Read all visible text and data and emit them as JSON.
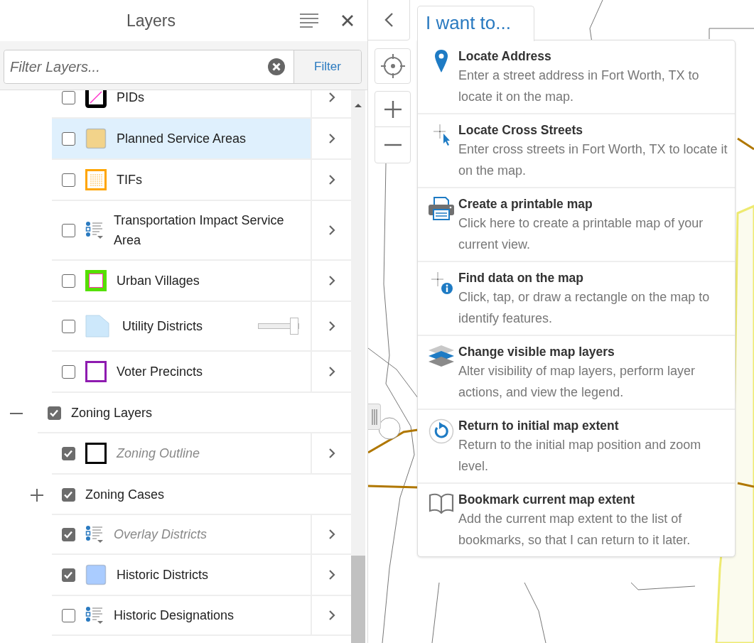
{
  "panel": {
    "title": "Layers"
  },
  "filter": {
    "placeholder": "Filter Layers...",
    "button": "Filter"
  },
  "layer_tree": [
    {
      "kind": "group",
      "children": [
        {
          "kind": "layer",
          "label": "PIDs",
          "checked": false,
          "selected": false,
          "out_of_scale": false,
          "legend": {
            "kind": "hatched",
            "color": "#000000"
          }
        },
        {
          "kind": "layer",
          "label": "Planned Service Areas",
          "checked": false,
          "selected": true,
          "out_of_scale": false,
          "legend": {
            "kind": "fill",
            "color": "#f2d38a"
          }
        },
        {
          "kind": "layer",
          "label": "TIFs",
          "checked": false,
          "selected": false,
          "out_of_scale": false,
          "legend": {
            "kind": "dotted",
            "color": "#ffa500"
          }
        },
        {
          "kind": "layer",
          "label": "Transportation Impact Service Area",
          "checked": false,
          "selected": false,
          "out_of_scale": false,
          "legend": {
            "kind": "list"
          }
        },
        {
          "kind": "layer",
          "label": "Urban Villages",
          "checked": false,
          "selected": false,
          "out_of_scale": false,
          "legend": {
            "kind": "double-outline",
            "color": "#55e000"
          }
        },
        {
          "kind": "layer",
          "label": "Utility Districts",
          "checked": false,
          "selected": false,
          "out_of_scale": false,
          "legend": {
            "kind": "polygon",
            "color": "#cde8fb"
          },
          "opacity": {
            "level": 1
          }
        },
        {
          "kind": "layer",
          "label": "Voter Precincts",
          "checked": false,
          "selected": false,
          "out_of_scale": false,
          "legend": {
            "kind": "outline",
            "color": "#8e1bb0"
          }
        }
      ]
    },
    {
      "kind": "group",
      "label": "Zoning Layers",
      "checked": true,
      "expanded": true,
      "children": [
        {
          "kind": "layer",
          "label": "Zoning Outline",
          "checked": true,
          "selected": false,
          "out_of_scale": true,
          "legend": {
            "kind": "outline",
            "color": "#000000"
          }
        },
        {
          "kind": "group",
          "label": "Zoning Cases",
          "checked": true,
          "expanded": false
        },
        {
          "kind": "layer",
          "label": "Overlay Districts",
          "checked": true,
          "selected": false,
          "out_of_scale": true,
          "legend": {
            "kind": "list"
          }
        },
        {
          "kind": "layer",
          "label": "Historic Districts",
          "checked": true,
          "selected": false,
          "out_of_scale": false,
          "legend": {
            "kind": "fill",
            "color": "#aaccff"
          }
        },
        {
          "kind": "layer",
          "label": "Historic Designations",
          "checked": false,
          "selected": false,
          "out_of_scale": false,
          "legend": {
            "kind": "list"
          }
        }
      ]
    }
  ],
  "menu": {
    "title": "I want to...",
    "items": [
      {
        "kind": "pin",
        "title": "Locate Address",
        "description": "Enter a street address in Fort Worth, TX to locate it on the map."
      },
      {
        "kind": "cross-cursor",
        "title": "Locate Cross Streets",
        "description": "Enter cross streets in Fort Worth, TX to locate it on the map."
      },
      {
        "kind": "printer",
        "title": "Create a printable map",
        "description": "Click here to create a printable map of your current view."
      },
      {
        "kind": "cross-info",
        "title": "Find data on the map",
        "description": "Click, tap, or draw a rectangle on the map to identify features."
      },
      {
        "kind": "layers",
        "title": "Change visible map layers",
        "description": "Alter visibility of map layers, perform layer actions, and view the legend."
      },
      {
        "kind": "reset",
        "title": "Return to initial map extent",
        "description": "Return to the initial map position and zoom level."
      },
      {
        "kind": "book",
        "title": "Bookmark current map extent",
        "description": "Add the current map extent to the list of bookmarks, so that I can return to it later."
      }
    ]
  }
}
